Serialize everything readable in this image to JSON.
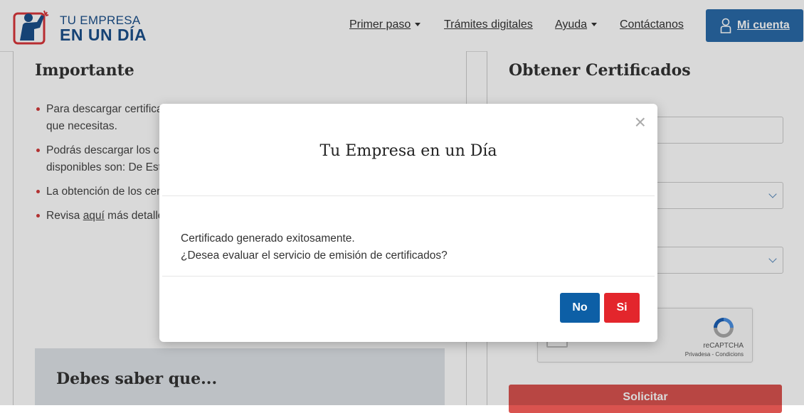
{
  "header": {
    "logo_line1": "TU EMPRESA",
    "logo_line2": "EN UN DÍA",
    "nav": {
      "primer_paso": "Primer paso",
      "tramites": "Trámites digitales",
      "ayuda": "Ayuda",
      "contacto": "Contáctanos"
    },
    "account_label": "Mi cuenta"
  },
  "left": {
    "heading": "Importante",
    "bullets": {
      "b1": "Para descargar certificados iniciar sesión, el RUT de la empresa y de certificado que necesitas.",
      "b2": "Podrás descargar los certificados o migradas al Registro. Los certificados disponibles son: De Estatuto actualizado, vigencia de poderes, de trámite.",
      "b3": "La obtención de los certificados es gratuita todo el año.",
      "b4_pre": "Revisa ",
      "b4_link": "aquí",
      "b4_post": " más detalles del Registro de Empresas y Sociedades."
    },
    "saber_title": "Debes saber que..."
  },
  "right": {
    "heading": "Obtener Certificados",
    "recaptcha_label": "reCAPTCHA",
    "recaptcha_links": "Privadesa - Condicions",
    "submit_label": "Solicitar"
  },
  "modal": {
    "title": "Tu Empresa en un Día",
    "close": "×",
    "line1": "Certificado generado exitosamente.",
    "line2": "¿Desea evaluar el servicio de emisión de certificados?",
    "btn_no": "No",
    "btn_si": "Si"
  },
  "colors": {
    "brand_blue": "#1b4f8a",
    "account_blue": "#2a6aa8",
    "no_blue": "#0d5fa6",
    "si_red": "#e3262c",
    "solicitar_red": "#d9534f"
  }
}
